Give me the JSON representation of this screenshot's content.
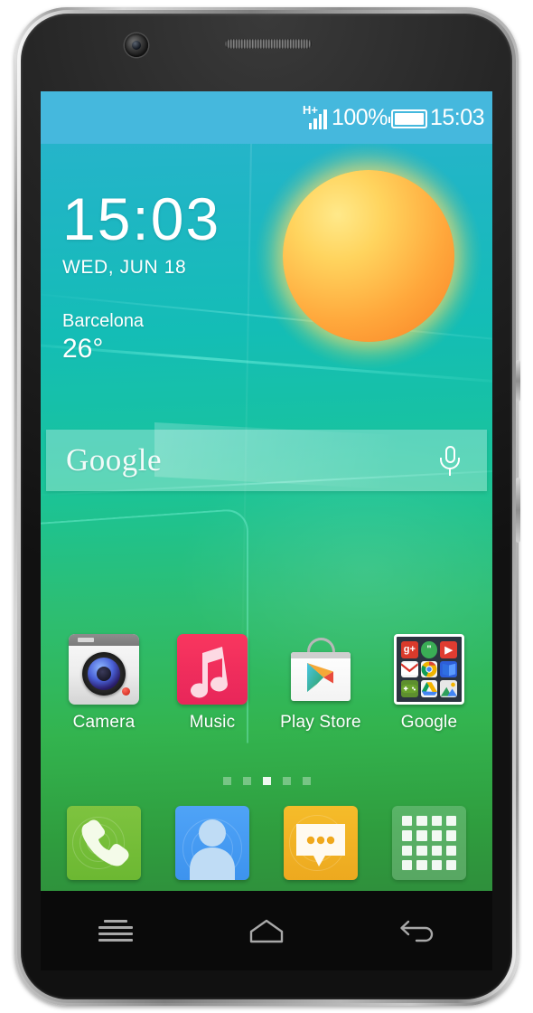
{
  "device": {
    "hardware": {
      "front_camera": "front-camera",
      "earpiece": "earpiece-speaker",
      "power_button": "power-button",
      "volume_button": "volume-button"
    }
  },
  "status_bar": {
    "network_type": "H+",
    "signal_bars": 4,
    "battery_percent": "100%",
    "battery_icon": "battery-full-icon",
    "clock": "15:03"
  },
  "clock_widget": {
    "time": "15:03",
    "date": "WED, JUN 18",
    "city": "Barcelona",
    "temperature": "26°",
    "weather_icon": "sun-icon"
  },
  "search": {
    "logo_text": "Google",
    "placeholder": "Google",
    "mic_icon": "microphone-icon"
  },
  "apps": [
    {
      "label": "Camera",
      "icon": "camera-icon"
    },
    {
      "label": "Music",
      "icon": "music-note-icon"
    },
    {
      "label": "Play Store",
      "icon": "play-store-icon"
    },
    {
      "label": "Google",
      "icon": "google-folder-icon"
    }
  ],
  "google_folder": {
    "items": [
      {
        "name": "google-plus-icon",
        "glyph": "g+"
      },
      {
        "name": "hangouts-icon",
        "glyph": "\""
      },
      {
        "name": "youtube-icon",
        "glyph": "▶"
      },
      {
        "name": "gmail-icon",
        "glyph": "M"
      },
      {
        "name": "chrome-icon",
        "glyph": "◉"
      },
      {
        "name": "play-books-icon",
        "glyph": "▼"
      },
      {
        "name": "play-games-icon",
        "glyph": "✛"
      },
      {
        "name": "drive-icon",
        "glyph": "▲"
      },
      {
        "name": "photos-icon",
        "glyph": "❖"
      }
    ]
  },
  "page_indicator": {
    "count": 5,
    "active_index": 2
  },
  "dock": [
    {
      "name": "phone-icon",
      "label": "Phone"
    },
    {
      "name": "contacts-icon",
      "label": "Contacts"
    },
    {
      "name": "messages-icon",
      "label": "Messages"
    },
    {
      "name": "app-drawer-icon",
      "label": "Apps"
    }
  ],
  "nav_bar": [
    {
      "name": "menu-icon",
      "label": "Menu"
    },
    {
      "name": "home-icon",
      "label": "Home"
    },
    {
      "name": "back-icon",
      "label": "Back"
    }
  ],
  "colors": {
    "status_bar": "#45b8dd",
    "wallpaper_top": "#2bb3cf",
    "wallpaper_bottom": "#2f8f3c",
    "music_pink": "#ef2d5c",
    "phone_green": "#6cb832",
    "contacts_blue": "#3d93ee",
    "messages_orange": "#eda91f",
    "sun_orange": "#ffa83c",
    "nav_bar": "#0a0a0a"
  }
}
